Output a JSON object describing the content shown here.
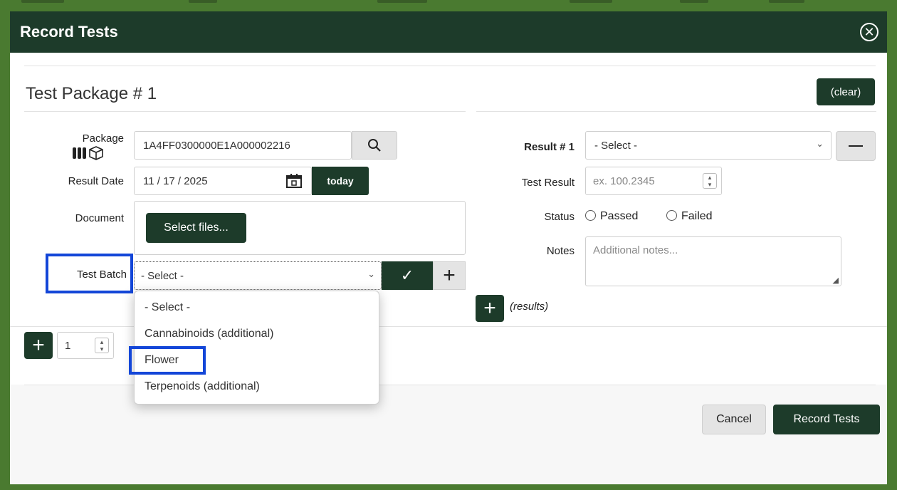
{
  "modal": {
    "title": "Record Tests"
  },
  "package_section": {
    "title": "Test Package # 1",
    "clear_label": "(clear)",
    "package_label": "Package",
    "package_value": "1A4FF0300000E1A000002216",
    "result_date_label": "Result Date",
    "result_date_value": "11 / 17 / 2025",
    "today_label": "today",
    "document_label": "Document",
    "select_files_label": "Select files...",
    "test_batch_label": "Test Batch",
    "test_batch_value": "- Select -",
    "stepper_value": "1"
  },
  "test_batch_options": [
    "- Select -",
    "Cannabinoids (additional)",
    "Flower",
    "Terpenoids (additional)"
  ],
  "result_section": {
    "result_label": "Result # 1",
    "result_select_value": "- Select -",
    "test_result_label": "Test Result",
    "test_result_placeholder": "ex. 100.2345",
    "status_label": "Status",
    "status_options": [
      "Passed",
      "Failed"
    ],
    "notes_label": "Notes",
    "notes_placeholder": "Additional notes...",
    "add_results_label": "(results)"
  },
  "footer": {
    "cancel_label": "Cancel",
    "record_label": "Record Tests"
  },
  "colors": {
    "header_bg": "#1d3b2a",
    "frame_green": "#4a7a30",
    "highlight_blue": "#1346d8"
  }
}
